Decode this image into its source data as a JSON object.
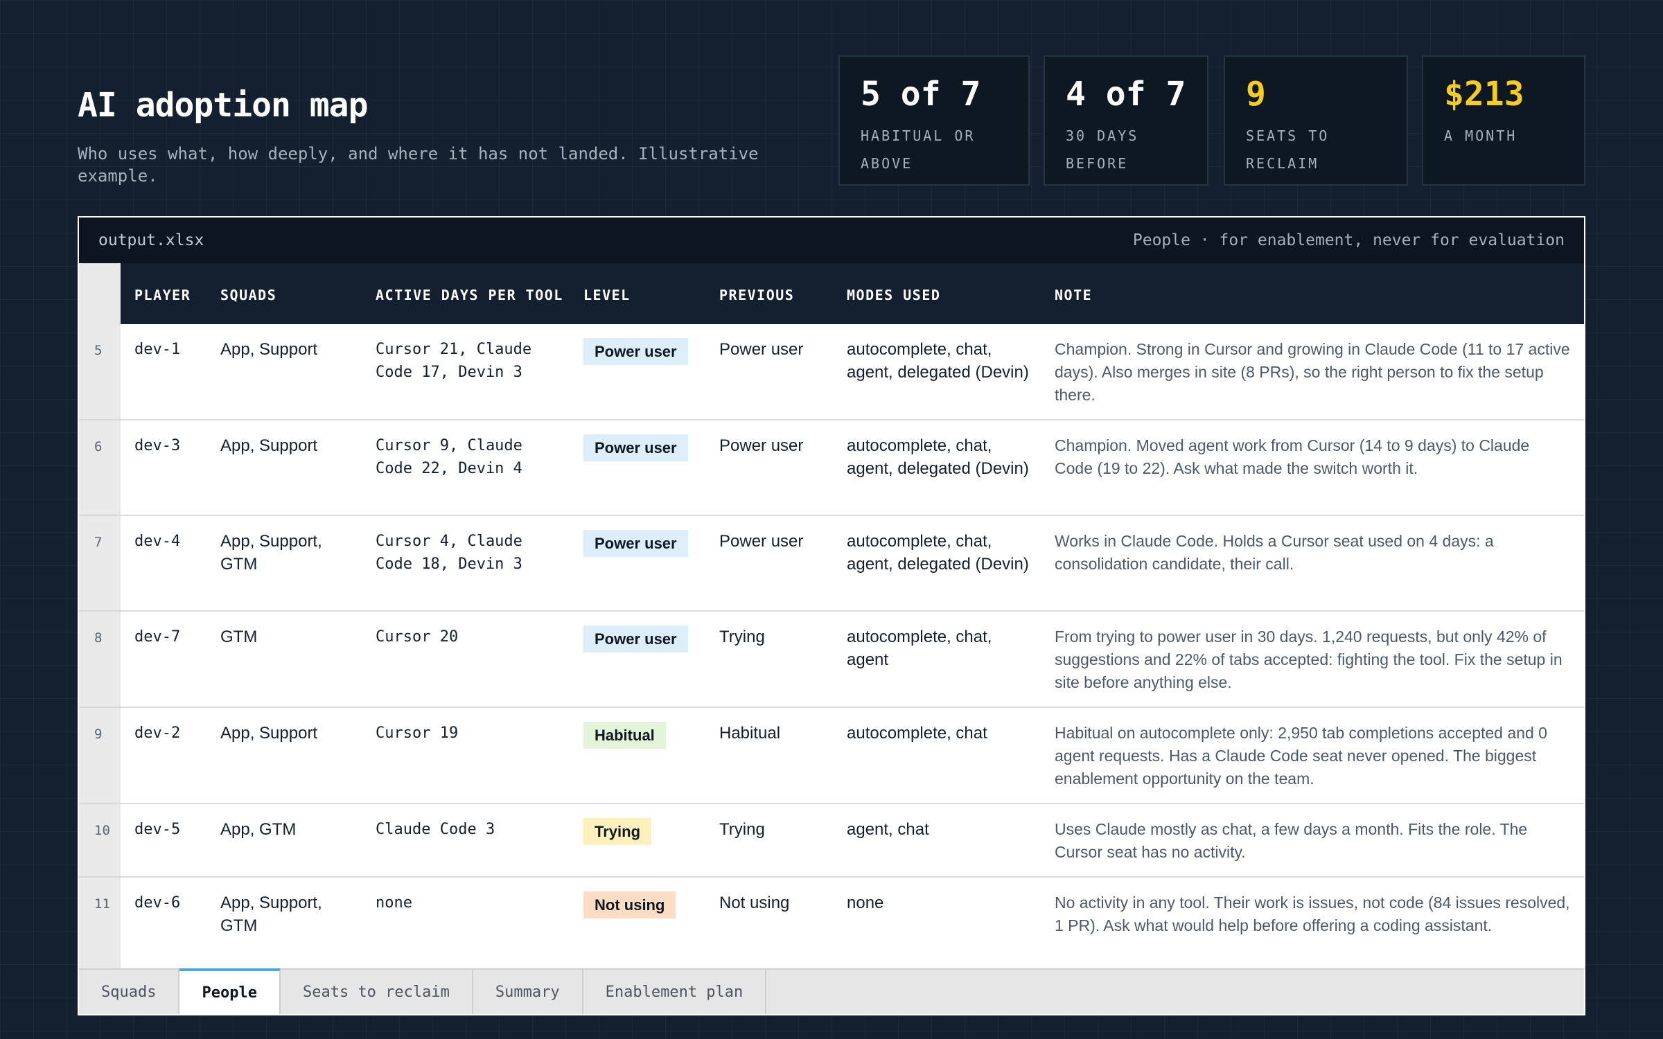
{
  "header": {
    "title": "AI adoption map",
    "subtitle": "Who uses what, how deeply, and where it has not landed. Illustrative example."
  },
  "stats": [
    {
      "value": "5 of 7",
      "label": "Habitual or above"
    },
    {
      "value": "4 of 7",
      "label": "30 days before"
    },
    {
      "value": "9",
      "label": "Seats to reclaim"
    },
    {
      "value": "$213",
      "label": "A month"
    }
  ],
  "sheet": {
    "file_name": "output.xlsx",
    "note": "People · for enablement, never for evaluation",
    "columns": [
      "Player",
      "Squads",
      "Active days per tool",
      "Level",
      "Previous",
      "Modes used",
      "Note"
    ],
    "rows": [
      {
        "num": "5",
        "player": "dev-1",
        "squads": "App, Support",
        "active_days": "Cursor 21, Claude Code 17, Devin 3",
        "level": "Power user",
        "previous": "Power user",
        "modes": "autocomplete, chat, agent, delegated (Devin)",
        "note": "Champion. Strong in Cursor and growing in Claude Code (11 to 17 active days). Also merges in site (8 PRs), so the right person to fix the setup there."
      },
      {
        "num": "6",
        "player": "dev-3",
        "squads": "App, Support",
        "active_days": "Cursor 9, Claude Code 22, Devin 4",
        "level": "Power user",
        "previous": "Power user",
        "modes": "autocomplete, chat, agent, delegated (Devin)",
        "note": "Champion. Moved agent work from Cursor (14 to 9 days) to Claude Code (19 to 22). Ask what made the switch worth it."
      },
      {
        "num": "7",
        "player": "dev-4",
        "squads": "App, Support, GTM",
        "active_days": "Cursor 4, Claude Code 18, Devin 3",
        "level": "Power user",
        "previous": "Power user",
        "modes": "autocomplete, chat, agent, delegated (Devin)",
        "note": "Works in Claude Code. Holds a Cursor seat used on 4 days: a consolidation candidate, their call."
      },
      {
        "num": "8",
        "player": "dev-7",
        "squads": "GTM",
        "active_days": "Cursor 20",
        "level": "Power user",
        "previous": "Trying",
        "modes": "autocomplete, chat, agent",
        "note": "From trying to power user in 30 days. 1,240 requests, but only 42% of suggestions and 22% of tabs accepted: fighting the tool. Fix the setup in site before anything else."
      },
      {
        "num": "9",
        "player": "dev-2",
        "squads": "App, Support",
        "active_days": "Cursor 19",
        "level": "Habitual",
        "previous": "Habitual",
        "modes": "autocomplete, chat",
        "note": "Habitual on autocomplete only: 2,950 tab completions accepted and 0 agent requests. Has a Claude Code seat never opened. The biggest enablement opportunity on the team."
      },
      {
        "num": "10",
        "player": "dev-5",
        "squads": "App, GTM",
        "active_days": "Claude Code 3",
        "level": "Trying",
        "previous": "Trying",
        "modes": "agent, chat",
        "note": "Uses Claude mostly as chat, a few days a month. Fits the role. The Cursor seat has no activity."
      },
      {
        "num": "11",
        "player": "dev-6",
        "squads": "App, Support, GTM",
        "active_days": "none",
        "level": "Not using",
        "previous": "Not using",
        "modes": "none",
        "note": "No activity in any tool. Their work is issues, not code (84 issues resolved, 1 PR). Ask what would help before offering a coding assistant."
      }
    ]
  },
  "level_colors": {
    "Power user": "#dbeef9",
    "Habitual": "#e4f4d9",
    "Trying": "#fdf0bd",
    "Not using": "#fcdcc5"
  },
  "tabs": [
    {
      "label": "Squads",
      "active": false
    },
    {
      "label": "People",
      "active": true
    },
    {
      "label": "Seats to reclaim",
      "active": false
    },
    {
      "label": "Summary",
      "active": false
    },
    {
      "label": "Enablement plan",
      "active": false
    }
  ]
}
